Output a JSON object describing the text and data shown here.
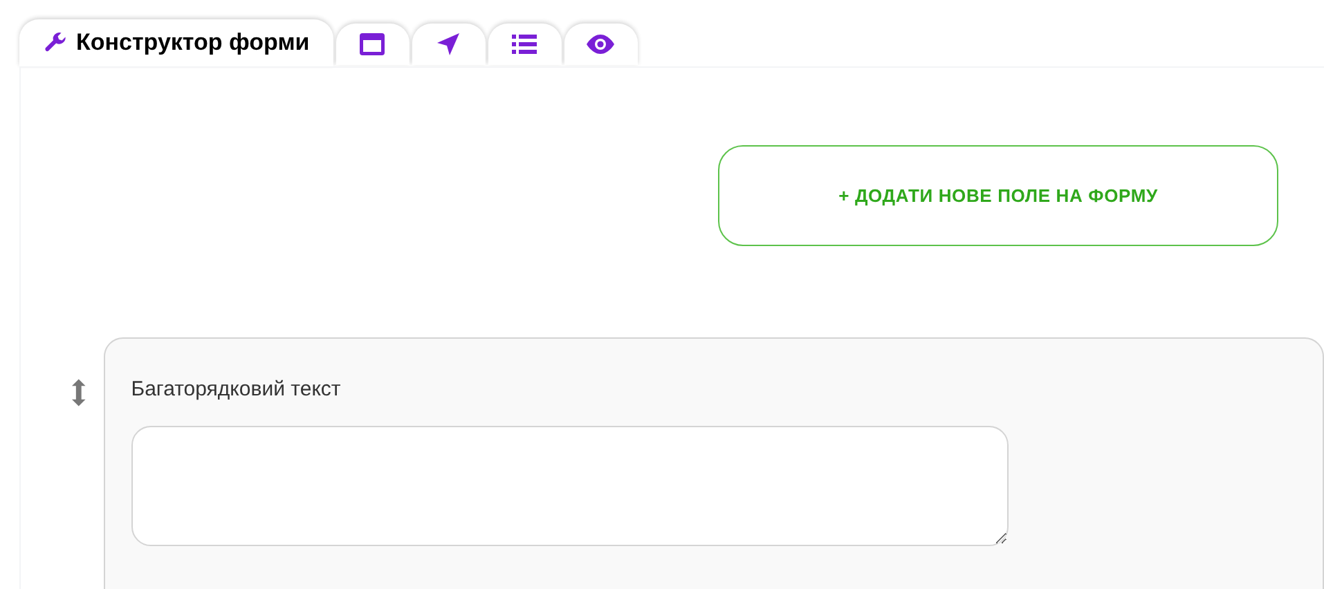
{
  "tabs": [
    {
      "kind": "wrench",
      "label": "Конструктор форми",
      "selected": true
    },
    {
      "kind": "window",
      "selected": false
    },
    {
      "kind": "navigate",
      "selected": false
    },
    {
      "kind": "list",
      "selected": false
    },
    {
      "kind": "eye",
      "selected": false
    }
  ],
  "add_field_button": "+ ДОДАТИ НОВЕ ПОЛЕ НА ФОРМУ",
  "fields": [
    {
      "kind": "textarea",
      "label": "Багаторядковий текст"
    }
  ]
}
